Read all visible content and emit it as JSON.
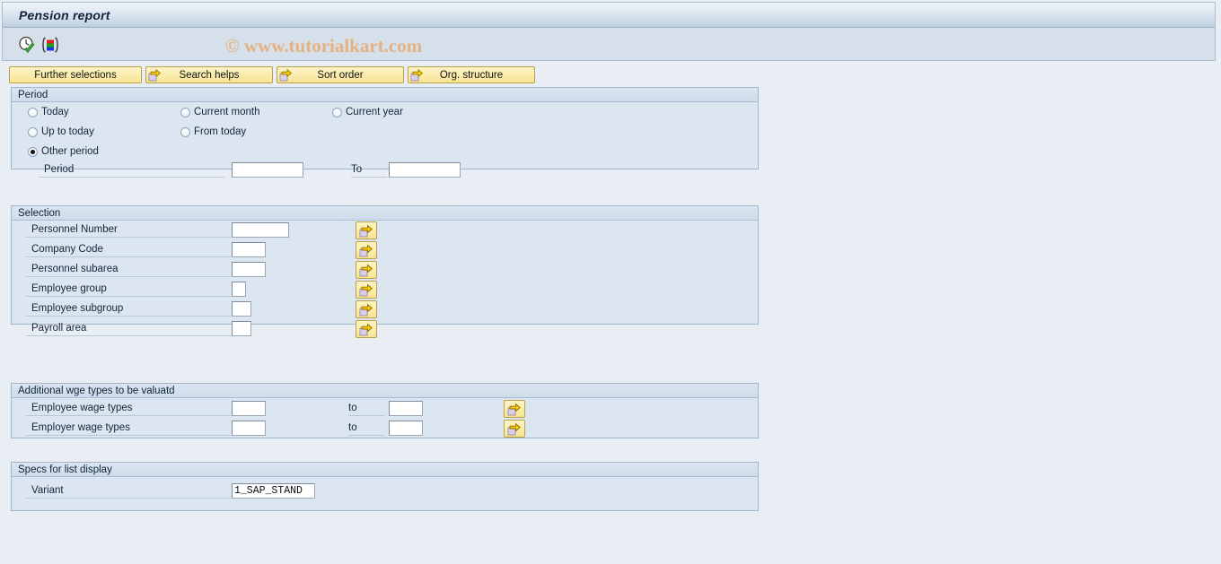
{
  "window": {
    "title": "Pension report"
  },
  "toolbar": {
    "icons": [
      {
        "name": "execute-clock-icon",
        "label": "Execute"
      },
      {
        "name": "variant-bars-icon",
        "label": "Get Variant"
      }
    ],
    "watermark": "© www.tutorialkart.com"
  },
  "action_buttons": [
    {
      "label": "Further selections",
      "has_arrow": false
    },
    {
      "label": "Search helps",
      "has_arrow": true
    },
    {
      "label": "Sort order",
      "has_arrow": true
    },
    {
      "label": "Org. structure",
      "has_arrow": true
    }
  ],
  "period": {
    "header": "Period",
    "options": [
      {
        "label": "Today",
        "selected": false
      },
      {
        "label": "Current month",
        "selected": false
      },
      {
        "label": "Current year",
        "selected": false
      },
      {
        "label": "Up to today",
        "selected": false
      },
      {
        "label": "From today",
        "selected": false
      },
      {
        "label": "Other period",
        "selected": true
      }
    ],
    "period_label": "Period",
    "period_value": "",
    "to_label": "To",
    "to_value": ""
  },
  "selection": {
    "header": "Selection",
    "fields": [
      {
        "label": "Personnel Number",
        "value": "",
        "input_width": 64,
        "has_arrow": true
      },
      {
        "label": "Company Code",
        "value": "",
        "input_width": 38,
        "has_arrow": true
      },
      {
        "label": "Personnel subarea",
        "value": "",
        "input_width": 38,
        "has_arrow": true
      },
      {
        "label": "Employee group",
        "value": "",
        "input_width": 16,
        "has_arrow": true
      },
      {
        "label": "Employee subgroup",
        "value": "",
        "input_width": 22,
        "has_arrow": true
      },
      {
        "label": "Payroll area",
        "value": "",
        "input_width": 22,
        "has_arrow": true
      }
    ]
  },
  "wage_types": {
    "header": "Additional wge types to be valuatd",
    "rows": [
      {
        "label": "Employee wage types",
        "from_value": "",
        "to_label": "to",
        "to_value": "",
        "has_arrow": true
      },
      {
        "label": "Employer wage types",
        "from_value": "",
        "to_label": "to",
        "to_value": "",
        "has_arrow": true
      }
    ]
  },
  "list_display": {
    "header": "Specs for list display",
    "variant_label": "Variant",
    "variant_value": "1_SAP_STAND"
  },
  "colors": {
    "accent_yellow": "#f7e391",
    "panel_blue": "#dce6f0",
    "header_blue": "#cedcea",
    "page_bg": "#e9eef5",
    "watermark": "#e4b183"
  }
}
